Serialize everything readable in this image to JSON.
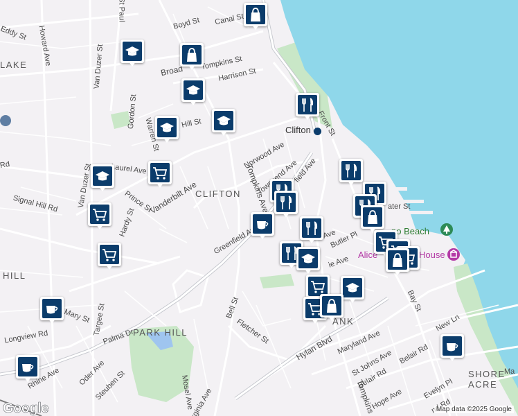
{
  "map": {
    "attribution": "Map data ©2025 Google",
    "logo": "Google",
    "areas": [
      "CLIFTON",
      "PARK HILL",
      "SHORE ACRE",
      "LAKE",
      "HILL"
    ],
    "streets": [
      "St Paul",
      "Eddy St",
      "Howard Ave",
      "Van Duzer St",
      "Boyd St",
      "Canal St",
      "Broad",
      "Tompkins St",
      "Harrison St",
      "Gordon St",
      "Warren St",
      "Hill St",
      "Bay St",
      "Front St",
      "Clifton",
      "Norwood Ave",
      "Townsend Ave",
      "Tompkins Ave",
      "field Ave",
      "Laurel Ave",
      "Vanderbilt Ave",
      "Van Duzer St",
      "Signal Hill Rd",
      "Prince St",
      "Hardy St",
      "Greenfield Ave",
      "Vanderbilt Ave",
      "Rd",
      "Butler Pl",
      "Ave",
      "Targee St",
      "Mary St",
      "Palma Dr",
      "Longview Rd",
      "Rhine Ave",
      "Oder Ave",
      "Steuben St",
      "Mosel Ave",
      "Bell St",
      "Fletcher St",
      "Hylan Blvd",
      "Maryland Ave",
      "St Johns Ave",
      "Belair Rd",
      "Belair Rd",
      "Hope Ave",
      "Evelyn Pl",
      "New Ln",
      "Bay St",
      "Tompkins",
      "Virginia Ave",
      "ater St",
      "nd Rd",
      "ANK",
      "ie Ave",
      "Ma"
    ],
    "pois": [
      "Alice",
      "House",
      "no Beach"
    ],
    "station_icon": "subway-icon",
    "icons": {
      "bag": "shopping-bag-icon",
      "edu": "school-icon",
      "food": "restaurant-icon",
      "cart": "grocery-cart-icon",
      "cup": "cafe-icon"
    },
    "colors": {
      "water": "#8fd7ea",
      "park": "#c9e7c7",
      "pin": "#0b3c6b",
      "poi": "#b43aa6"
    }
  }
}
